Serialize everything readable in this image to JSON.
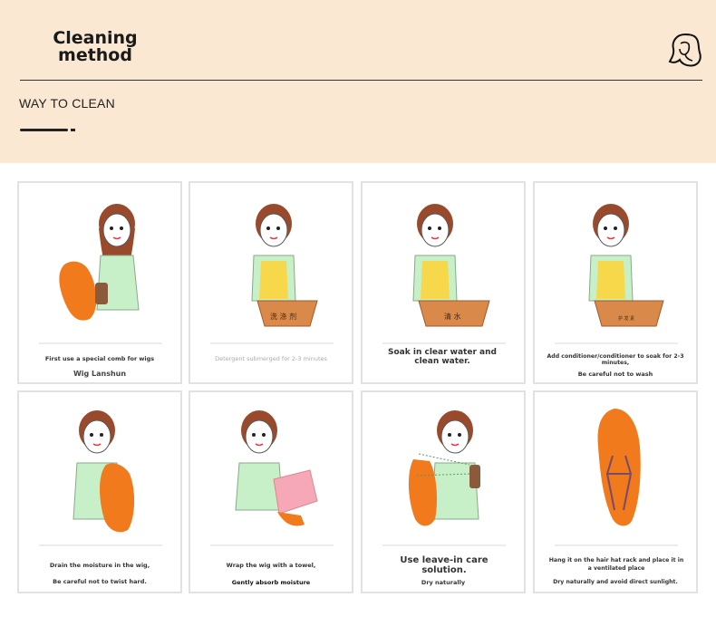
{
  "header": {
    "title_line1": "Cleaning",
    "title_line2": "method",
    "subtitle": "WAY TO CLEAN",
    "logo_icon": "woman-silhouette-icon",
    "background": "#fbe8d2"
  },
  "steps": [
    {
      "caption": "First use a special comb for wigs",
      "subcaption": "Wig Lanshun",
      "icon": "comb-wig-illustration"
    },
    {
      "caption": "Detergent submerged for 2-3 minutes",
      "subcaption": "",
      "basin_label": "洗 涤 剂",
      "icon": "detergent-basin-illustration"
    },
    {
      "caption": "Soak in clear water and clean water.",
      "subcaption": "",
      "basin_label": "清 水",
      "icon": "clear-water-basin-illustration"
    },
    {
      "caption": "Add conditioner/conditioner to soak for 2-3 minutes,",
      "subcaption": "Be careful not to wash",
      "basin_label": "护 发 素",
      "icon": "conditioner-basin-illustration"
    },
    {
      "caption": "Drain the moisture in the wig,",
      "subcaption": "Be careful not to twist hard.",
      "icon": "drain-wig-illustration"
    },
    {
      "caption": "Wrap the wig with a towel,",
      "subcaption": "Gently absorb moisture",
      "icon": "towel-wig-illustration"
    },
    {
      "caption": "Use leave-in care solution.",
      "subcaption": "Dry naturally",
      "icon": "spray-wig-illustration"
    },
    {
      "caption": "Hang it on the hair hat rack and place it in a ventilated place",
      "subcaption": "Dry naturally and avoid direct sunlight.",
      "icon": "hanging-wig-illustration"
    }
  ],
  "colors": {
    "hair": "#f07a1c",
    "shirt": "#c8f0c8",
    "apron": "#f7d84a",
    "basin": "#d98a4a",
    "towel": "#f6a8b8"
  }
}
